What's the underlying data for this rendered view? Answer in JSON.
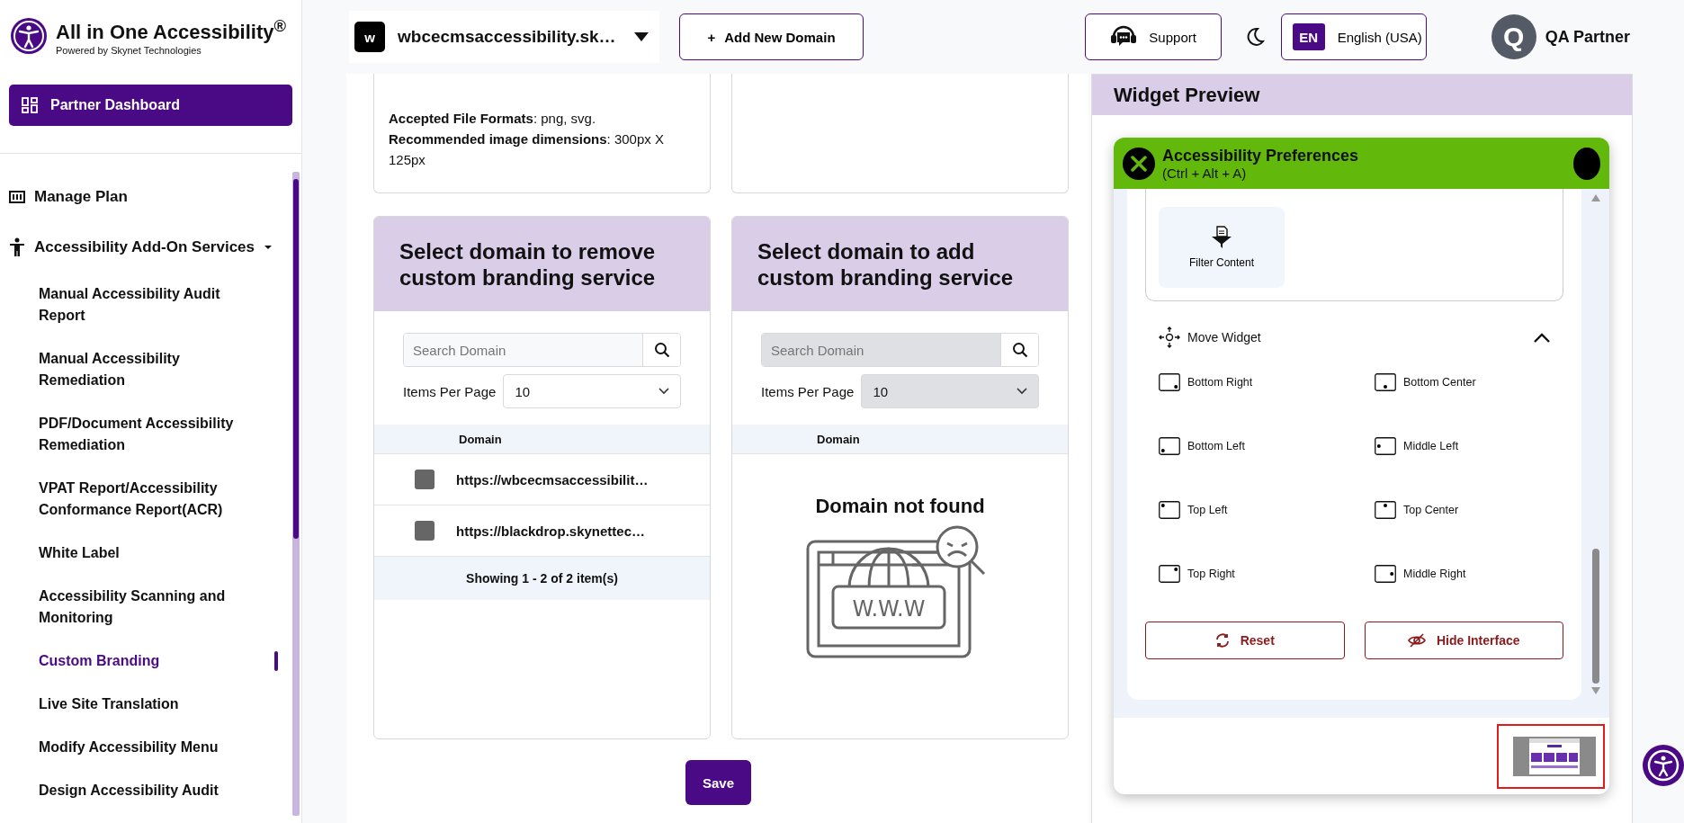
{
  "brand": {
    "title": "All in One Accessibility$^{®}$",
    "subtitle": "Powered by Skynet Technologies"
  },
  "dashboard_button": "Partner Dashboard",
  "nav": [
    {
      "label": "Manage Plan",
      "kind": "plan"
    },
    {
      "label": "Accessibility Add-On Services",
      "kind": "services",
      "expanded": true,
      "children": [
        {
          "label": "Manual Accessibility Audit Report",
          "selected": false
        },
        {
          "label": "Manual Accessibility Remediation",
          "selected": false
        },
        {
          "label": "PDF/Document Accessibility Remediation",
          "selected": false
        },
        {
          "label": "VPAT Report/Accessibility Conformance Report(ACR)",
          "selected": false
        },
        {
          "label": "White Label",
          "selected": false
        },
        {
          "label": "Accessibility Scanning and Monitoring",
          "selected": false
        },
        {
          "label": "Custom Branding",
          "selected": true
        },
        {
          "label": "Live Site Translation",
          "selected": false
        },
        {
          "label": "Modify Accessibility Menu",
          "selected": false
        },
        {
          "label": "Design Accessibility Audit",
          "selected": false
        }
      ]
    }
  ],
  "header": {
    "domain": {
      "badge": "w",
      "value": "wbcecmsaccessibility.sk…"
    },
    "add_domain": {
      "icon": "+",
      "label": "Add New Domain"
    },
    "support": "Support",
    "language": {
      "code": "EN",
      "label": "English (USA)"
    },
    "user": {
      "initial": "Q",
      "name": "QA Partner"
    }
  },
  "upload_card": {
    "lines": [
      "**Accepted File Formats**: png, svg.",
      "**Recommended image dimensions**: 300px X 125px"
    ]
  },
  "domain_panels": [
    {
      "title": "Select domain to remove custom branding service",
      "search": {
        "placeholder": "Search Domain",
        "disabled": false
      },
      "items_per_page": {
        "label": "Items Per Page",
        "value": "10",
        "disabled": false
      },
      "columns": [
        "Domain"
      ],
      "rows": [
        {
          "domain": "https://wbcecmsaccessibilit…",
          "checked": false
        },
        {
          "domain": "https://blackdrop.skynettec…",
          "checked": false
        }
      ],
      "footer": "Showing 1 - 2 of 2 item(s)"
    },
    {
      "title": "Select domain to add custom branding service",
      "search": {
        "placeholder": "Search Domain",
        "disabled": true
      },
      "items_per_page": {
        "label": "Items Per Page",
        "value": "10",
        "disabled": true
      },
      "columns": [
        "Domain"
      ],
      "empty": {
        "message": "Domain not found",
        "illustration_text": "W.W.W"
      }
    }
  ],
  "save_button": "Save",
  "widget_preview": {
    "title": "Widget Preview",
    "popup": {
      "title": "Accessibility Preferences",
      "shortcut": "(Ctrl + Alt + A)",
      "tiles": [
        {
          "label": "Filter Content"
        }
      ],
      "section": {
        "title": "Move Widget",
        "expanded": true,
        "options": [
          {
            "label": "Bottom Right",
            "kind": "bottomright"
          },
          {
            "label": "Bottom Center",
            "kind": "bottomcenter"
          },
          {
            "label": "Bottom Left",
            "kind": "bottomleft"
          },
          {
            "label": "Middle Left",
            "kind": "middleleft"
          },
          {
            "label": "Top Left",
            "kind": "topleft"
          },
          {
            "label": "Top Center",
            "kind": "topcenter"
          },
          {
            "label": "Top Right",
            "kind": "topright"
          },
          {
            "label": "Middle Right",
            "kind": "middleright"
          }
        ]
      },
      "buttons": [
        {
          "kind": "reset",
          "label": "Reset"
        },
        {
          "kind": "hide",
          "label": "Hide Interface"
        }
      ]
    }
  }
}
